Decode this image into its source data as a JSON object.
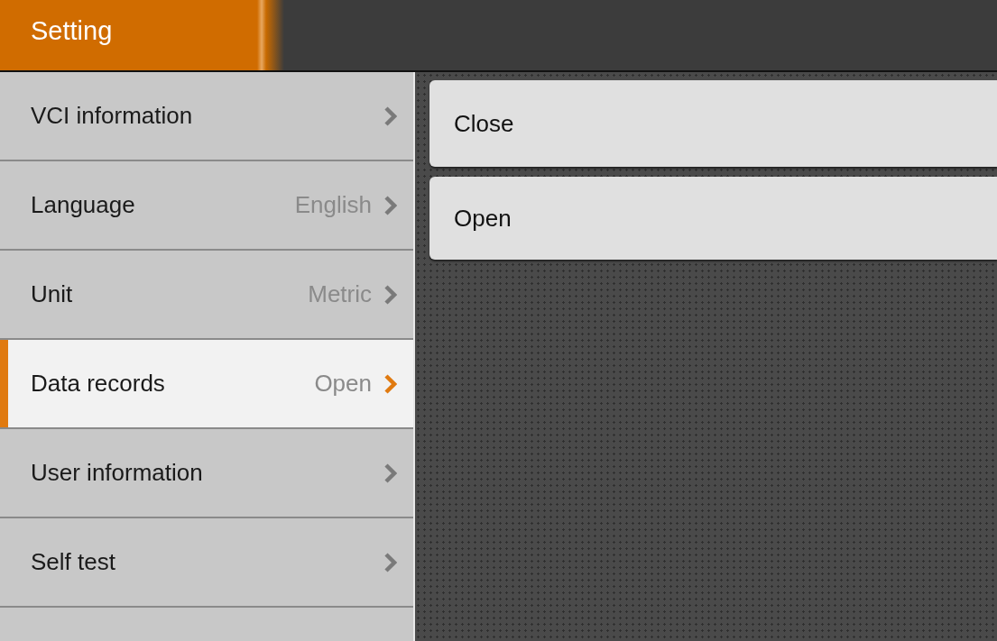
{
  "header": {
    "title": "Setting"
  },
  "sidebar": {
    "items": [
      {
        "label": "VCI information",
        "selected": false
      },
      {
        "label": "Language",
        "value": "English",
        "selected": false
      },
      {
        "label": "Unit",
        "value": "Metric",
        "selected": false
      },
      {
        "label": "Data records",
        "value": "Open",
        "selected": true
      },
      {
        "label": "User information",
        "selected": false
      },
      {
        "label": "Self test",
        "selected": false
      }
    ]
  },
  "options": [
    {
      "label": "Close"
    },
    {
      "label": "Open"
    }
  ]
}
